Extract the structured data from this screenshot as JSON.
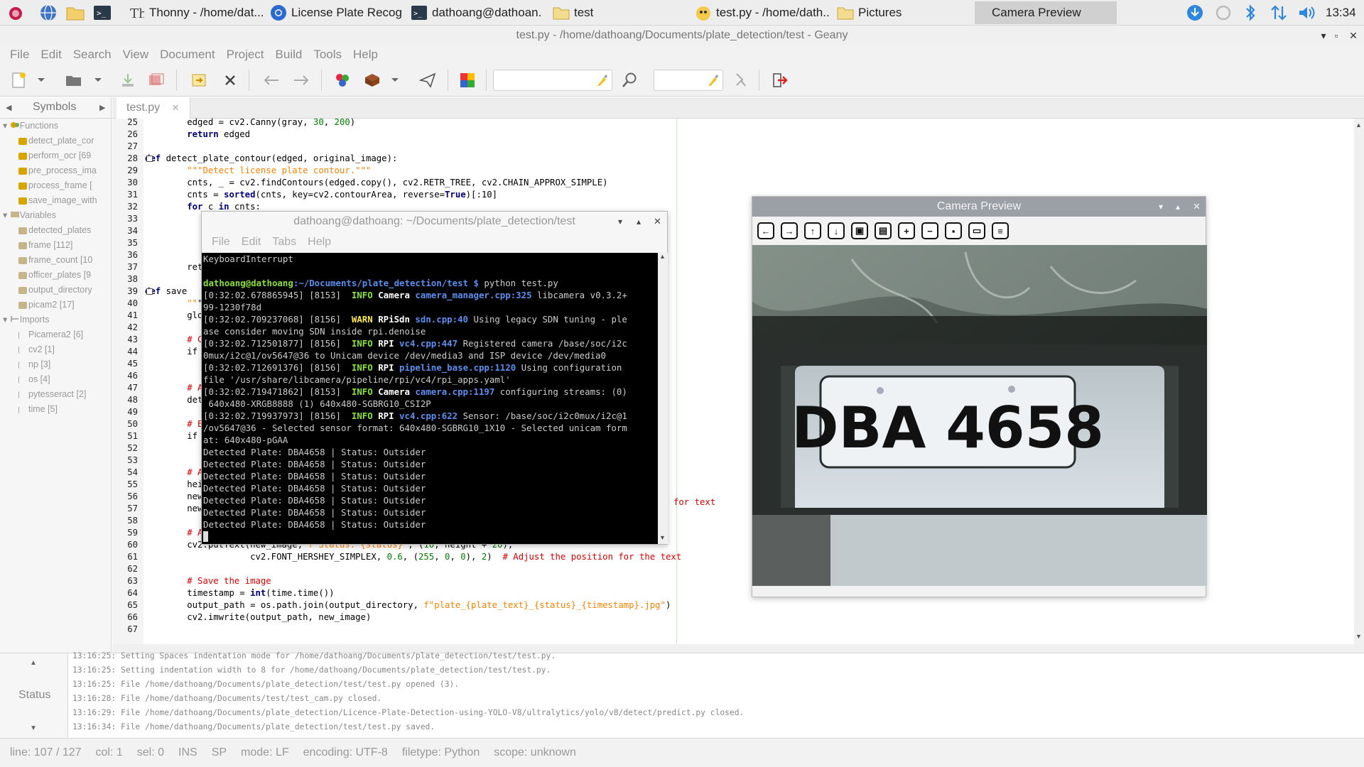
{
  "taskbar": {
    "tasks": [
      {
        "label": "Thonny  -  /home/dat..."
      },
      {
        "label": "License Plate Recog..."
      },
      {
        "label": "dathoang@dathoan..."
      },
      {
        "label": "test"
      },
      {
        "label": "test.py - /home/dath..."
      },
      {
        "label": "Pictures"
      },
      {
        "label": "Camera Preview"
      }
    ],
    "clock": "13:34",
    "icons": [
      "raspberry-icon",
      "globe-icon",
      "folder-icon",
      "terminal-icon",
      "download-icon",
      "sync-icon",
      "bluetooth-icon",
      "network-icon",
      "volume-icon"
    ]
  },
  "window": {
    "title": "test.py - /home/dathoang/Documents/plate_detection/test - Geany"
  },
  "menu": [
    "File",
    "Edit",
    "Search",
    "View",
    "Document",
    "Project",
    "Build",
    "Tools",
    "Help"
  ],
  "sidebar": {
    "tab": "Symbols",
    "groups": [
      {
        "label": "Functions",
        "items": [
          "detect_plate_cor",
          "perform_ocr [69",
          "pre_process_ima",
          "process_frame [",
          "save_image_with"
        ]
      },
      {
        "label": "Variables",
        "items": [
          "detected_plates",
          "frame [112]",
          "frame_count [10",
          "officer_plates [9",
          "output_directory",
          "picam2 [17]"
        ]
      },
      {
        "label": "Imports",
        "items": [
          "Picamera2 [6]",
          "cv2 [1]",
          "np [3]",
          "os [4]",
          "pytesseract [2]",
          "time [5]"
        ]
      }
    ]
  },
  "editor": {
    "tab": "test.py",
    "first_line": 25,
    "lines": [
      "        edged = cv2.Canny(gray, 30, 200)",
      "        return edged",
      "",
      "def detect_plate_contour(edged, original_image):",
      "        \"\"\"Detect license plate contour.\"\"\"",
      "        cnts, _ = cv2.findContours(edged.copy(), cv2.RETR_TREE, cv2.CHAIN_APPROX_SIMPLE)",
      "        cnts = sorted(cnts, key=cv2.contourArea, reverse=True)[:10]",
      "        for c in cnts:",
      "",
      "",
      "",
      "",
      "        retu",
      "",
      "def save",
      "        \"\"\"S",
      "        glob",
      "",
      "        # Ch",
      "        if p",
      "",
      "",
      "        # Ad",
      "        dete",
      "",
      "        # En",
      "        if c",
      "",
      "",
      "        # Ad",
      "        heig",
      "        new_",
      "        new_",
      "",
      "        # Ad",
      "        cv2.putText(new_image, f\"Status: {status}\", (10, height + 20),",
      "                    cv2.FONT_HERSHEY_SIMPLEX, 0.6, (255, 0, 0), 2)  # Adjust the position for the text",
      "",
      "        # Save the image",
      "        timestamp = int(time.time())",
      "        output_path = os.path.join(output_directory, f\"plate_{plate_text}_{status}_{timestamp}.jpg\")",
      "        cv2.imwrite(output_path, new_image)",
      ""
    ],
    "hidden_fragment_56": "for text"
  },
  "messages": {
    "tab": "Status",
    "lines": [
      "13:16:25: Setting Spaces indentation mode for /home/dathoang/Documents/plate_detection/test/test.py.",
      "13:16:25: Setting indentation width to 8 for /home/dathoang/Documents/plate_detection/test/test.py.",
      "13:16:25: File /home/dathoang/Documents/plate_detection/test/test.py opened (3).",
      "13:16:28: File /home/dathoang/Documents/test/test_cam.py closed.",
      "13:16:29: File /home/dathoang/Documents/plate_detection/Licence-Plate-Detection-using-YOLO-V8/ultralytics/yolo/v8/detect/predict.py closed.",
      "13:16:34: File /home/dathoang/Documents/plate_detection/test/test.py saved."
    ]
  },
  "status": {
    "line": "line: 107 / 127",
    "col": "col: 1",
    "sel": "sel: 0",
    "ins": "INS",
    "sp": "SP",
    "mode": "mode: LF",
    "encoding": "encoding: UTF-8",
    "filetype": "filetype: Python",
    "scope": "scope: unknown"
  },
  "terminal": {
    "title": "dathoang@dathoang: ~/Documents/plate_detection/test",
    "menu": [
      "File",
      "Edit",
      "Tabs",
      "Help"
    ],
    "prompt_user": "dathoang@dathoang",
    "prompt_path": ":~/Documents/plate_detection/test $",
    "command": " python test.py",
    "lines": [
      {
        "pre": "[0:32:02.678865945] [8153]  ",
        "lvl": "INFO",
        "cat": "Camera",
        "src": "camera_manager.cpp:325",
        "msg": " libcamera v0.3.2+"
      },
      {
        "plain": "99-1230f78d"
      },
      {
        "pre": "[0:32:02.709237068] [8156]  ",
        "lvl": "WARN",
        "cat": "RPiSdn",
        "src": "sdn.cpp:40",
        "msg": " Using legacy SDN tuning - ple"
      },
      {
        "plain": "ase consider moving SDN inside rpi.denoise"
      },
      {
        "pre": "[0:32:02.712501877] [8156]  ",
        "lvl": "INFO",
        "cat": "RPI",
        "src": "vc4.cpp:447",
        "msg": " Registered camera /base/soc/i2c"
      },
      {
        "plain": "0mux/i2c@1/ov5647@36 to Unicam device /dev/media3 and ISP device /dev/media0"
      },
      {
        "pre": "[0:32:02.712691376] [8156]  ",
        "lvl": "INFO",
        "cat": "RPI",
        "src": "pipeline_base.cpp:1120",
        "msg": " Using configuration"
      },
      {
        "plain": "file '/usr/share/libcamera/pipeline/rpi/vc4/rpi_apps.yaml'"
      },
      {
        "pre": "[0:32:02.719471862] [8153]  ",
        "lvl": "INFO",
        "cat": "Camera",
        "src": "camera.cpp:1197",
        "msg": " configuring streams: (0)"
      },
      {
        "plain": " 640x480-XRGB8888 (1) 640x480-SGBRG10_CSI2P"
      },
      {
        "pre": "[0:32:02.719937973] [8156]  ",
        "lvl": "INFO",
        "cat": "RPI",
        "src": "vc4.cpp:622",
        "msg": " Sensor: /base/soc/i2c0mux/i2c@1"
      },
      {
        "plain": "/ov5647@36 - Selected sensor format: 640x480-SGBRG10_1X10 - Selected unicam form"
      },
      {
        "plain": "at: 640x480-pGAA"
      },
      {
        "plain": "Detected Plate: DBA4658 | Status: Outsider"
      },
      {
        "plain": "Detected Plate: DBA4658 | Status: Outsider"
      },
      {
        "plain": "Detected Plate: DBA4658 | Status: Outsider"
      },
      {
        "plain": "Detected Plate: DBA4658 | Status: Outsider"
      },
      {
        "plain": "Detected Plate: DBA4658 | Status: Outsider"
      },
      {
        "plain": "Detected Plate: DBA4658 | Status: Outsider"
      },
      {
        "plain": "Detected Plate: DBA4658 | Status: Outsider"
      }
    ],
    "first_line": "KeyboardInterrupt"
  },
  "camera": {
    "title": "Camera Preview",
    "plate_text": "DBA 4658",
    "tools": [
      "arrow-left-icon",
      "arrow-right-icon",
      "arrow-up-icon",
      "arrow-down-icon",
      "fit-icon",
      "image-icon",
      "zoom-in-icon",
      "zoom-out-icon",
      "save-icon",
      "clipboard-icon",
      "settings-icon"
    ]
  }
}
